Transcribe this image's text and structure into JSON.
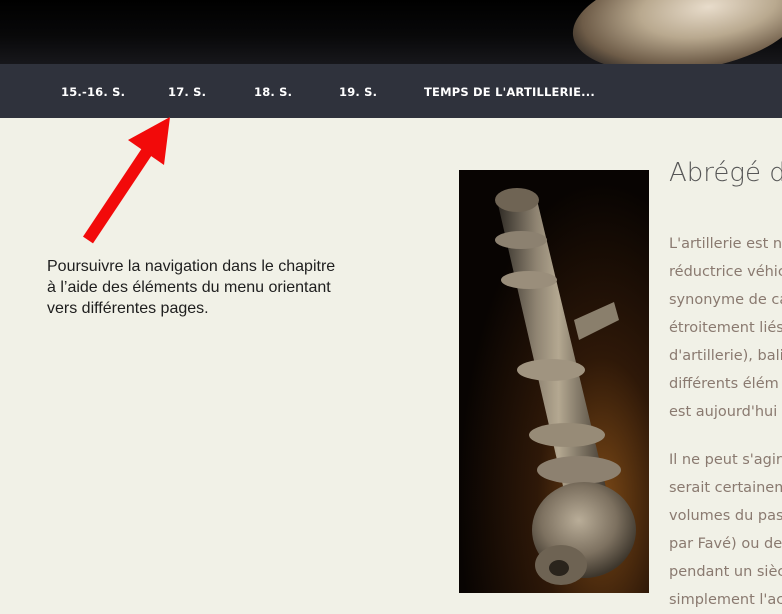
{
  "nav": {
    "items": [
      {
        "label": "15.-16. S."
      },
      {
        "label": "17. S."
      },
      {
        "label": "18. S."
      },
      {
        "label": "19. S."
      },
      {
        "label": "TEMPS DE L'ARTILLERIE..."
      }
    ]
  },
  "annotation": {
    "lines": [
      "Poursuivre la  navigation dans le chapitre",
      "à l’aide des éléments du menu orientant",
      "vers différentes pages."
    ],
    "arrow_color": "#f20a0a"
  },
  "article": {
    "title": "Abrégé d",
    "paragraph1": [
      "L'artillerie est n",
      "réductrice véhic",
      "synonyme de ca",
      "étroitement liés",
      "d'artillerie), bali",
      "différents élém",
      "est aujourd'hui"
    ],
    "paragraph2": [
      "Il ne peut s'agir",
      "serait certainem",
      "volumes du pass",
      "par Favé) ou des",
      "pendant un sièc",
      "simplement l'ac"
    ]
  },
  "colors": {
    "background": "#f1f1e7",
    "nav_background": "#2f323c",
    "nav_text": "#ffffff",
    "body_text": "#8a7a70",
    "title_text": "#565656"
  }
}
